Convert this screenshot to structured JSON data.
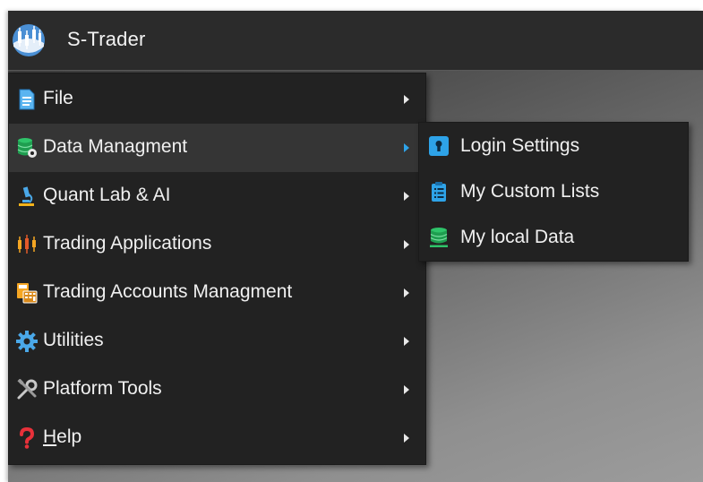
{
  "app": {
    "title": "S-Trader",
    "logo_icon": "candlestick-logo-icon"
  },
  "menu": {
    "items": [
      {
        "label": "File",
        "icon": "document-icon"
      },
      {
        "label": "Data Managment",
        "icon": "database-gear-icon",
        "active": true
      },
      {
        "label": "Quant Lab & AI",
        "icon": "microscope-icon"
      },
      {
        "label": "Trading Applications",
        "icon": "candlestick-icon"
      },
      {
        "label": "Trading Accounts Managment",
        "icon": "calculator-icon"
      },
      {
        "label": "Utilities",
        "icon": "gear-icon"
      },
      {
        "label": "Platform Tools",
        "icon": "tools-icon"
      },
      {
        "label_mnemonic": "H",
        "label_rest": "elp",
        "icon": "question-icon"
      }
    ]
  },
  "submenu": {
    "items": [
      {
        "label": "Login Settings",
        "icon": "lock-icon"
      },
      {
        "label": "My Custom Lists",
        "icon": "clipboard-list-icon"
      },
      {
        "label": "My local Data",
        "icon": "database-icon"
      }
    ]
  },
  "colors": {
    "menu_bg": "#222222",
    "menu_active_bg": "#353535",
    "titlebar_bg": "#2b2b2b",
    "accent": "#2ea3e8"
  }
}
